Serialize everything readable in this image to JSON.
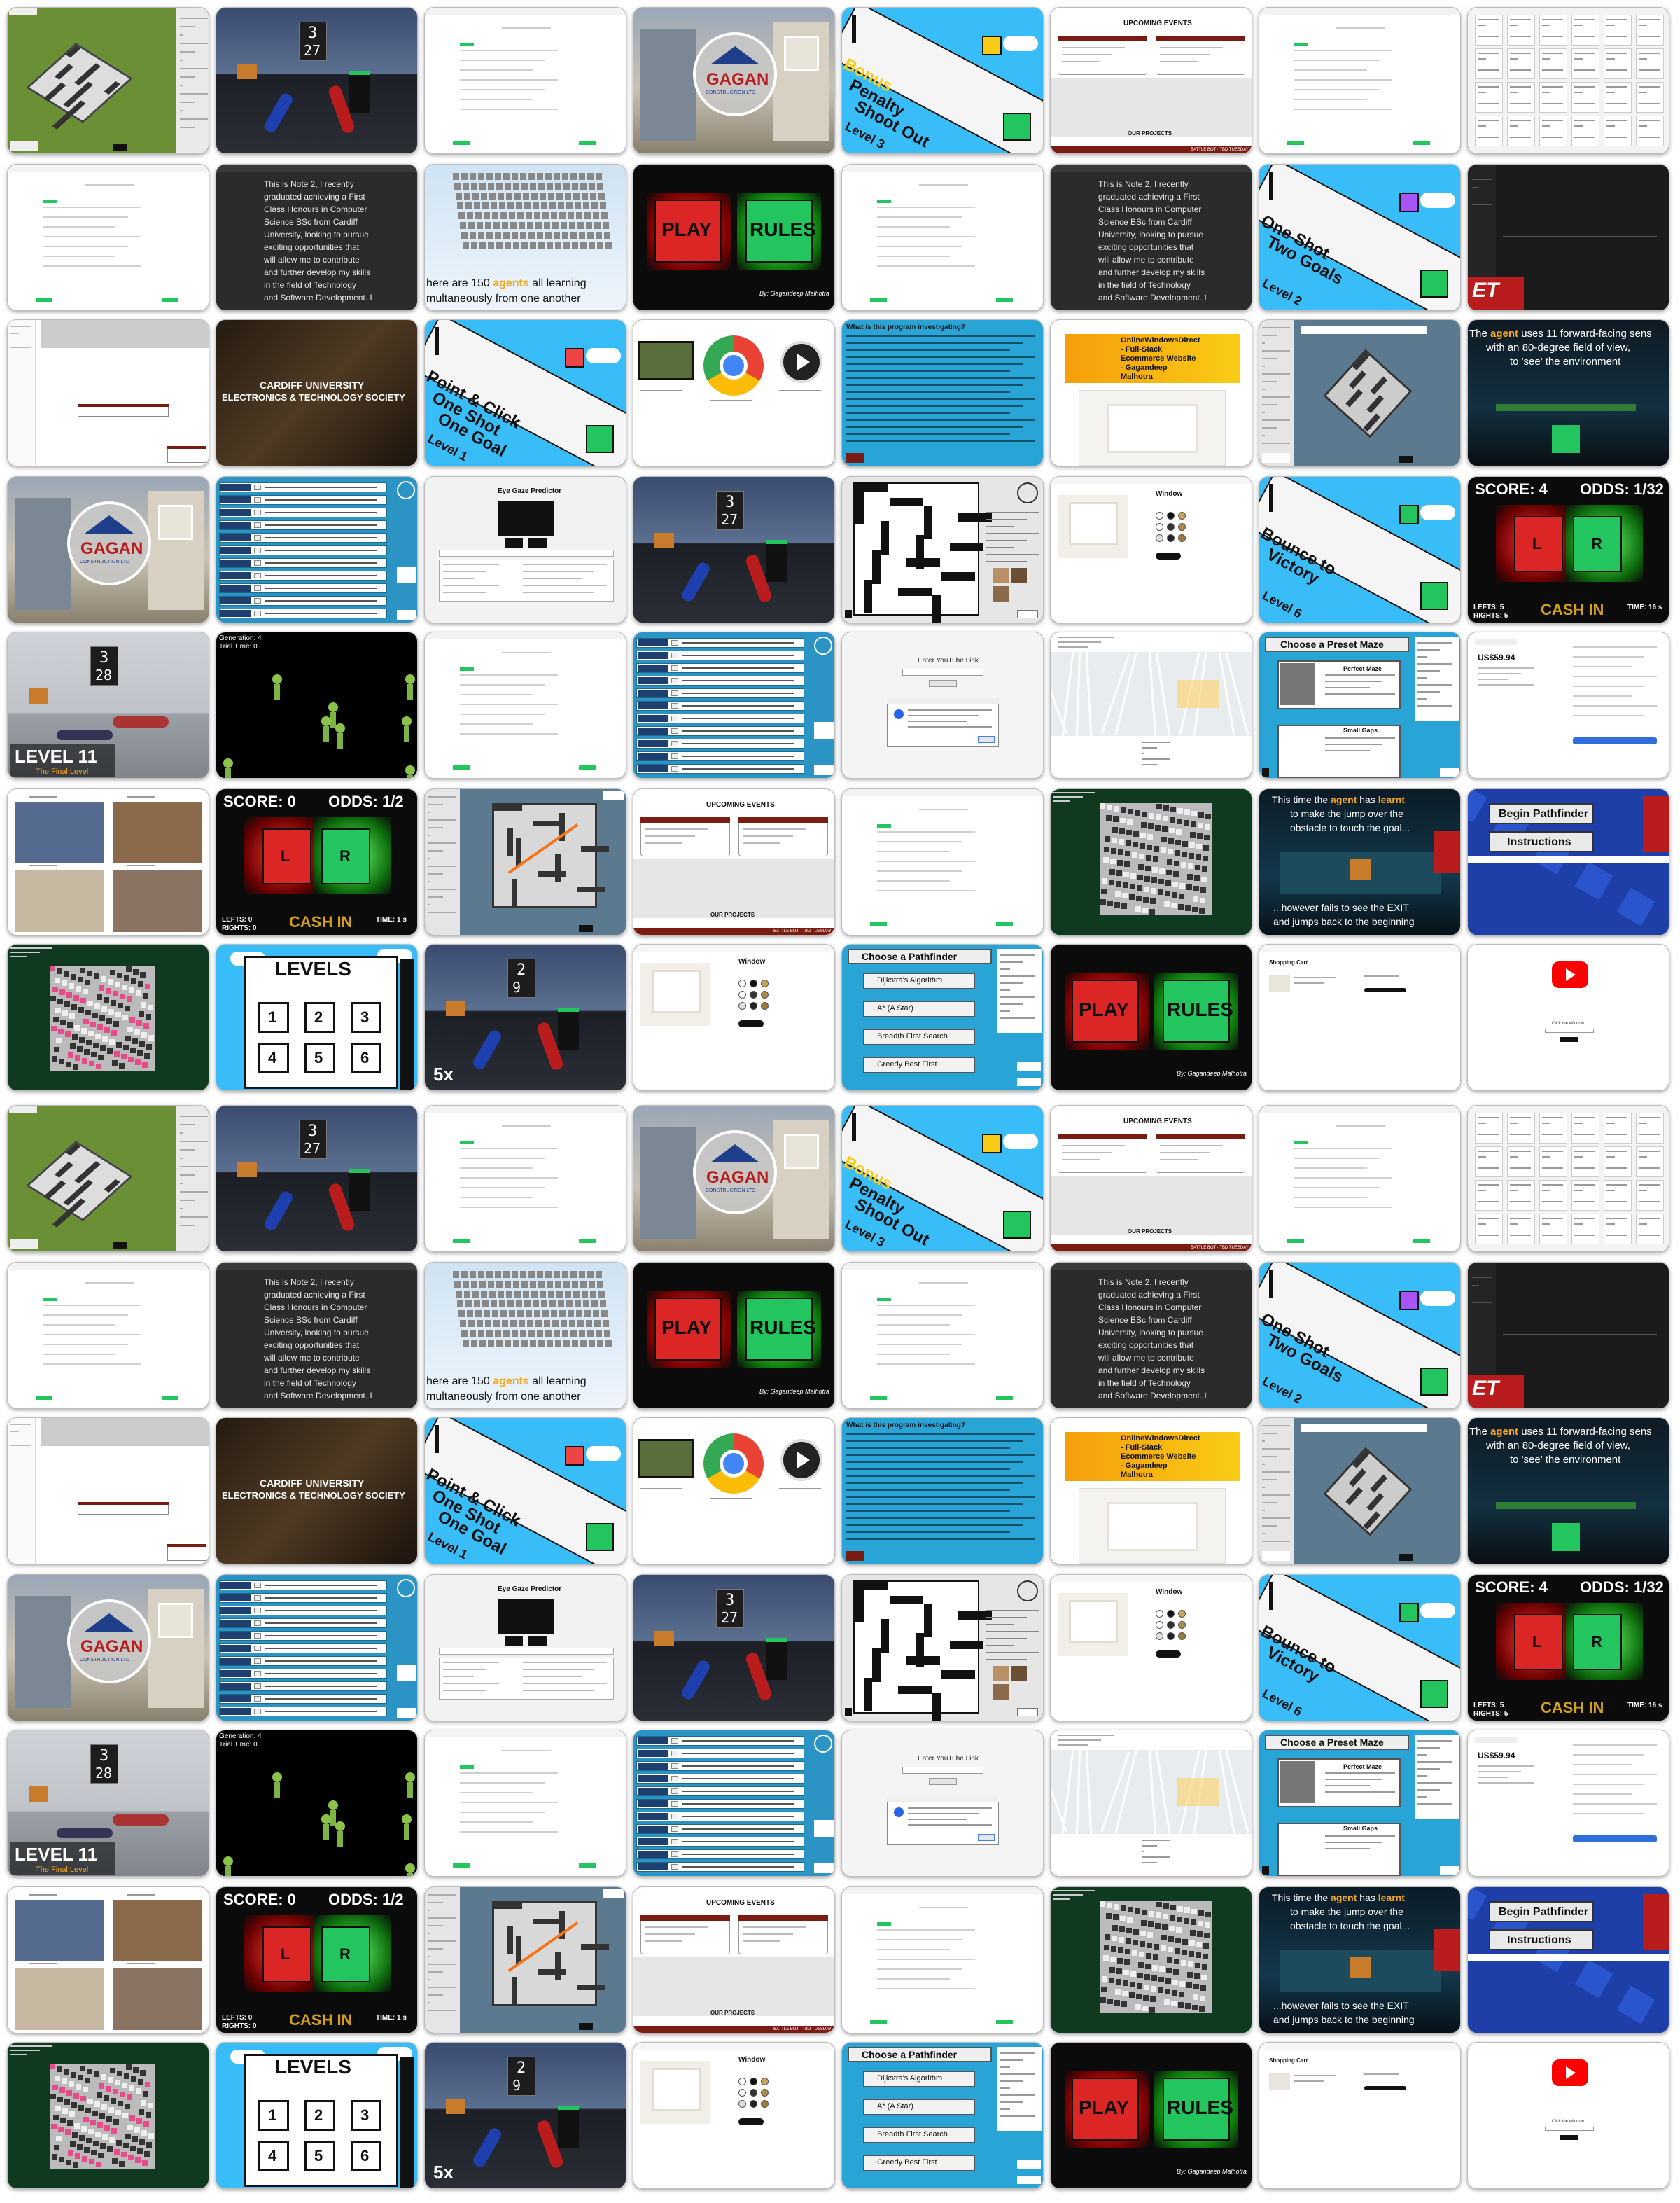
{
  "page": {
    "title": "Project thumbnails wall"
  },
  "colors": {
    "green_play": "#22c55e",
    "red_play": "#dc2626",
    "sky_blue": "#38bdf8",
    "maze_panel": "#29a4d6",
    "dark_bg": "#101214",
    "maroon": "#7a1c12",
    "orange_text": "#f5a623",
    "yellow": "#ffd000"
  },
  "block": [
    {
      "type": "maze3d"
    },
    {
      "type": "room3d",
      "n1": "3",
      "n2": "27"
    },
    {
      "type": "form"
    },
    {
      "type": "house",
      "brand": "GAGAN",
      "sub": "CONSTRUCTION LTD"
    },
    {
      "type": "level",
      "lines": [
        "Bonus",
        "Penalty",
        "Shoot Out"
      ],
      "level": "Level 3",
      "accent": "#facc15"
    },
    {
      "type": "events",
      "title": "UPCOMING EVENTS",
      "foot": "OUR PROJECTS",
      "bar": "BATTLE BOT · TBD TUESDAY"
    },
    {
      "type": "form"
    },
    {
      "type": "doc"
    },
    {
      "type": "form"
    },
    {
      "type": "note",
      "lines": [
        "This is Note 2, I recently",
        "graduated achieving a First",
        "Class Honours in Computer",
        "Science BSc from Cardiff",
        "University, looking to pursue",
        "exciting opportunities that",
        "will allow me to contribute",
        "and further develop my skills",
        "in the field of Technology",
        "and Software Development. I"
      ]
    },
    {
      "type": "agents",
      "l1a": "here are 150 ",
      "l1b": "agents",
      "l1c": " all learning",
      "l2": "multaneously from one another"
    },
    {
      "type": "playrules",
      "play": "PLAY",
      "rules": "RULES",
      "by": "By: Gagandeep Malhotra"
    },
    {
      "type": "form"
    },
    {
      "type": "note",
      "lines": [
        "This is Note 2, I recently",
        "graduated achieving a First",
        "Class Honours in Computer",
        "Science BSc from Cardiff",
        "University, looking to pursue",
        "exciting opportunities that",
        "will allow me to contribute",
        "and further develop my skills",
        "in the field of Technology",
        "and Software Development. I"
      ]
    },
    {
      "type": "level",
      "lines": [
        "One Shot",
        "Two Goals"
      ],
      "level": "Level 2",
      "accent": "#a855f7"
    },
    {
      "type": "darkdoc",
      "logo": "ET"
    },
    {
      "type": "dialog"
    },
    {
      "type": "cardiff",
      "l1": "CARDIFF UNIVERSITY",
      "l2": "ELECTRONICS & TECHNOLOGY SOCIETY"
    },
    {
      "type": "level",
      "lines": [
        "Point & Click",
        "One Shot",
        "One Goal"
      ],
      "level": "Level 1",
      "accent": "#ef4444"
    },
    {
      "type": "icons"
    },
    {
      "type": "bluetext",
      "title": "What is this program investigating?"
    },
    {
      "type": "shop",
      "l1": "OnlineWindowsDirect",
      "l2": "- Full-Stack",
      "l3": "Ecommerce Website",
      "l4": "- Gagandeep",
      "l5": "Malhotra"
    },
    {
      "type": "mazepanel"
    },
    {
      "type": "fov",
      "l1a": "The ",
      "l1b": "agent",
      "l1c": " uses 11 forward-facing sens",
      "l2": "with an 80-degree field of view,",
      "l3": "to 'see' the environment"
    },
    {
      "type": "house",
      "brand": "GAGAN",
      "sub": "CONSTRUCTION LTD"
    },
    {
      "type": "settings"
    },
    {
      "type": "eyegaze",
      "title": "Eye Gaze Predictor"
    },
    {
      "type": "room3d",
      "n1": "3",
      "n2": "27"
    },
    {
      "type": "crossword"
    },
    {
      "type": "product",
      "title": "Window"
    },
    {
      "type": "level",
      "lines": [
        "Bounce to",
        "Victory"
      ],
      "level": "Level 6",
      "accent": "#22c55e"
    },
    {
      "type": "odds",
      "score": "SCORE: 4",
      "odds": "ODDS: 1/32",
      "l": "L",
      "r": "R",
      "cash": "CASH IN",
      "lefts": "LEFTS: 5",
      "rights": "RIGHTS: 5",
      "time": "TIME: 16 s"
    },
    {
      "type": "level11",
      "n1": "3",
      "n2": "28",
      "title": "LEVEL 11",
      "sub": "The Final Level"
    },
    {
      "type": "aliens",
      "gen": "Generation: 4",
      "trial": "Trial Time: 0"
    },
    {
      "type": "form"
    },
    {
      "type": "settings"
    },
    {
      "type": "youtube",
      "label": "Enter YouTube Link"
    },
    {
      "type": "map"
    },
    {
      "type": "preset",
      "title": "Choose a Preset Maze",
      "m1": "Perfect Maze",
      "m2": "Small Gaps"
    },
    {
      "type": "checkout",
      "price": "US$59.94"
    },
    {
      "type": "gallery"
    },
    {
      "type": "odds",
      "score": "SCORE: 0",
      "odds": "ODDS: 1/2",
      "l": "L",
      "r": "R",
      "cash": "CASH IN",
      "lefts": "LEFTS: 0",
      "rights": "RIGHTS: 0",
      "time": "TIME: 1 s"
    },
    {
      "type": "mazepath"
    },
    {
      "type": "events",
      "title": "UPCOMING EVENTS",
      "foot": "OUR PROJECTS",
      "bar": "BATTLE BOT · TBD TUESDAY"
    },
    {
      "type": "form"
    },
    {
      "type": "noise"
    },
    {
      "type": "jump",
      "l1a": "This time the ",
      "l1b": "agent",
      "l1c": " has ",
      "l1d": "learnt",
      "l2": "to make the jump over the",
      "l3": "obstacle to touch the goal...",
      "l4": "...however fails to see the EXIT",
      "l5": "and jumps back to the beginning"
    },
    {
      "type": "pathfinder",
      "b1": "Begin Pathfinder",
      "b2": "Instructions"
    },
    {
      "type": "noise2"
    },
    {
      "type": "levels",
      "title": "LEVELS",
      "nums": [
        "1",
        "2",
        "3",
        "4",
        "5",
        "6"
      ]
    },
    {
      "type": "room3d5x",
      "n1": "2",
      "n2": "9",
      "speed": "5x"
    },
    {
      "type": "product",
      "title": "Window"
    },
    {
      "type": "algos",
      "title": "Choose a Pathfinder",
      "items": [
        "Dijkstra's Algorithm",
        "A* (A Star)",
        "Breadth First Search",
        "Greedy Best First"
      ]
    },
    {
      "type": "playrules",
      "play": "PLAY",
      "rules": "RULES",
      "by": "By: Gagandeep Malhotra"
    },
    {
      "type": "cart",
      "title": "Shopping Cart"
    },
    {
      "type": "yt",
      "label": "Click the Window"
    }
  ]
}
